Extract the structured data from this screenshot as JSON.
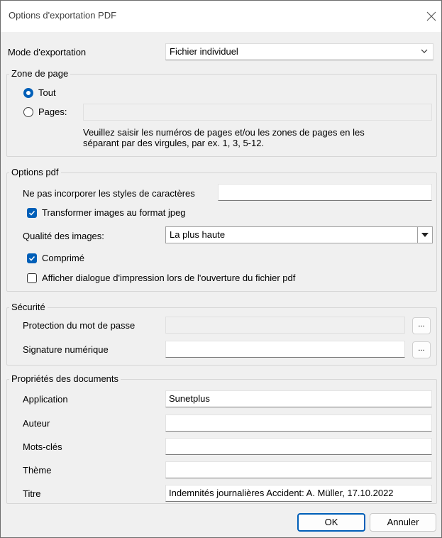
{
  "window": {
    "title": "Options d'exportation PDF"
  },
  "export_mode": {
    "label": "Mode d'exportation",
    "value": "Fichier individuel"
  },
  "page_zone": {
    "title": "Zone de page",
    "all_label": "Tout",
    "pages_label": "Pages:",
    "pages_value": "",
    "hint_line1": "Veuillez saisir les numéros de pages et/ou les zones de pages en les",
    "hint_line2": "séparant par des virgules, par ex. 1, 3, 5-12."
  },
  "pdf_options": {
    "title": "Options pdf",
    "no_embed_label": "Ne pas incorporer les styles de caractères",
    "no_embed_value": "",
    "jpeg_label": "Transformer images au format jpeg",
    "quality_label": "Qualité des images:",
    "quality_value": "La plus haute",
    "compressed_label": "Comprimé",
    "print_dialog_label": "Afficher dialogue d'impression lors de l'ouverture du fichier pdf"
  },
  "security": {
    "title": "Sécurité",
    "password_label": "Protection du mot de passe",
    "password_value": "",
    "signature_label": "Signature numérique",
    "signature_value": "",
    "browse_label": "..."
  },
  "doc_props": {
    "title": "Propriétés des documents",
    "application_label": "Application",
    "application_value": "Sunetplus",
    "author_label": "Auteur",
    "author_value": "",
    "keywords_label": "Mots-clés",
    "keywords_value": "",
    "theme_label": "Thème",
    "theme_value": "",
    "title_label": "Titre",
    "title_value": "Indemnités journalières Accident: A. Müller, 17.10.2022"
  },
  "buttons": {
    "ok": "OK",
    "cancel": "Annuler"
  },
  "colors": {
    "accent": "#005fb8",
    "dialog_bg": "#f0f0f0"
  }
}
